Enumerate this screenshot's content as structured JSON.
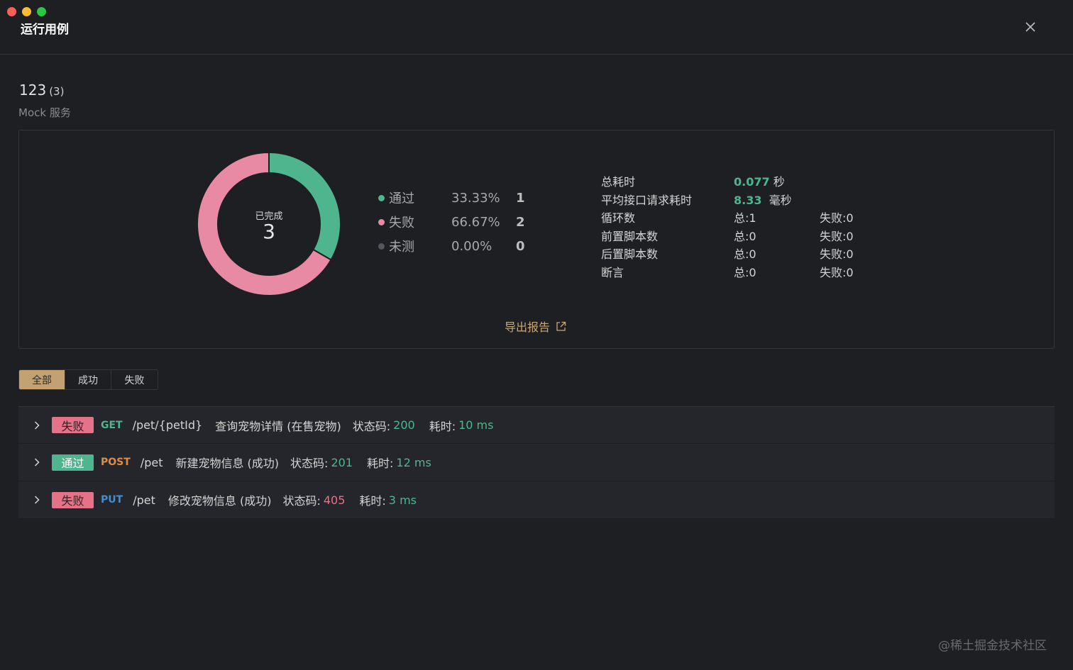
{
  "window": {
    "title": "运行用例"
  },
  "project": {
    "name": "123",
    "count": "(3)",
    "service": "Mock 服务"
  },
  "donut": {
    "label": "已完成",
    "total": "3",
    "passed": 1,
    "failed": 2,
    "untested": 0
  },
  "legend": [
    {
      "label": "通过",
      "pct": "33.33%",
      "count": "1",
      "color": "#4fb58f"
    },
    {
      "label": "失败",
      "pct": "66.67%",
      "count": "2",
      "color": "#e88aa3"
    },
    {
      "label": "未测",
      "pct": "0.00%",
      "count": "0",
      "color": "#55565b"
    }
  ],
  "stats": {
    "total_time": {
      "label": "总耗时",
      "value": "0.077",
      "unit": "秒"
    },
    "avg_time": {
      "label": "平均接口请求耗时",
      "value": "8.33",
      "unit": "毫秒"
    },
    "loops": {
      "label": "循环数",
      "total": "总:1",
      "failed": "失败:0"
    },
    "pre_scripts": {
      "label": "前置脚本数",
      "total": "总:0",
      "failed": "失败:0"
    },
    "post_scripts": {
      "label": "后置脚本数",
      "total": "总:0",
      "failed": "失败:0"
    },
    "assertions": {
      "label": "断言",
      "total": "总:0",
      "failed": "失败:0"
    }
  },
  "export": {
    "label": "导出报告"
  },
  "tabs": [
    {
      "label": "全部",
      "active": true
    },
    {
      "label": "成功",
      "active": false
    },
    {
      "label": "失败",
      "active": false
    }
  ],
  "results": [
    {
      "status": "失败",
      "status_type": "fail",
      "method": "GET",
      "path": "/pet/{petId}",
      "name": "查询宠物详情 (在售宠物)",
      "status_label": "状态码:",
      "status_code": "200",
      "code_ok": true,
      "time_label": "耗时:",
      "time": "10 ms"
    },
    {
      "status": "通过",
      "status_type": "pass",
      "method": "POST",
      "path": "/pet",
      "name": "新建宠物信息 (成功)",
      "status_label": "状态码:",
      "status_code": "201",
      "code_ok": true,
      "time_label": "耗时:",
      "time": "12 ms"
    },
    {
      "status": "失败",
      "status_type": "fail",
      "method": "PUT",
      "path": "/pet",
      "name": "修改宠物信息 (成功)",
      "status_label": "状态码:",
      "status_code": "405",
      "code_ok": false,
      "time_label": "耗时:",
      "time": "3 ms"
    }
  ],
  "watermark": "@稀土掘金技术社区",
  "colors": {
    "pass": "#4fb58f",
    "fail": "#e88aa3",
    "accent": "#c2a272",
    "background": "#1e1f23"
  }
}
